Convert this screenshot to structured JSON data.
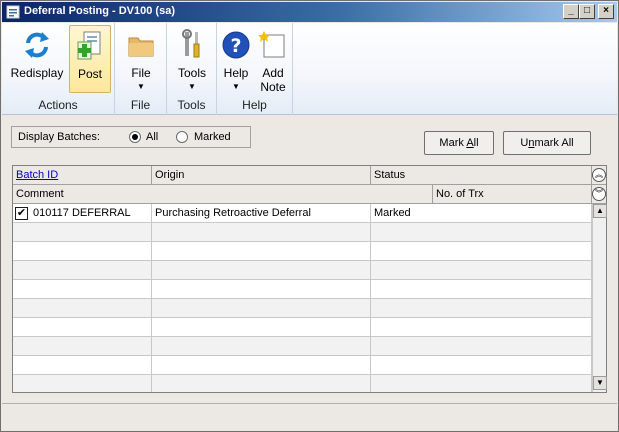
{
  "window": {
    "title": "Deferral Posting  -  DV100 (sa)",
    "controls": {
      "minimize": "_",
      "maximize": "□",
      "close": "×"
    }
  },
  "ribbon": {
    "groups": [
      {
        "label": "Actions",
        "buttons": [
          {
            "label": "Redisplay",
            "icon": "redisplay-icon"
          },
          {
            "label": "Post",
            "icon": "post-icon"
          }
        ]
      },
      {
        "label": "File",
        "buttons": [
          {
            "label": "File",
            "icon": "folder-icon",
            "arrow": "▼"
          }
        ]
      },
      {
        "label": "Tools",
        "buttons": [
          {
            "label": "Tools",
            "icon": "tools-icon",
            "arrow": "▼"
          }
        ]
      },
      {
        "label": "Help",
        "buttons": [
          {
            "label": "Help",
            "icon": "help-icon",
            "arrow": "▼"
          },
          {
            "label": "Add",
            "label2": "Note",
            "icon": "add-note-icon"
          }
        ]
      }
    ]
  },
  "display_batches": {
    "label": "Display Batches:",
    "options": [
      "All",
      "Marked"
    ],
    "selected": "All"
  },
  "buttons": {
    "mark_all_pre": "Mark ",
    "mark_all_u": "A",
    "mark_all_post": "ll",
    "unmark_all_pre": "U",
    "unmark_all_u": "n",
    "unmark_all_post": "mark All"
  },
  "grid": {
    "headers": {
      "batch_id": "Batch ID",
      "origin": "Origin",
      "status": "Status",
      "comment": "Comment",
      "no_of_trx": "No. of Trx"
    },
    "rows": [
      {
        "checked": true,
        "check_mark": "✔",
        "batch_id": "010117 DEFERRAL",
        "origin": "Purchasing Retroactive Deferral",
        "status": "Marked"
      }
    ],
    "scroll_up": "▲",
    "scroll_down": "▼",
    "collapse": "︽",
    "expand": "︾"
  },
  "colors": {
    "title_start": "#0a246a",
    "title_end": "#a6caf0",
    "link": "#0000cc",
    "post_active": "#ffe79b"
  }
}
